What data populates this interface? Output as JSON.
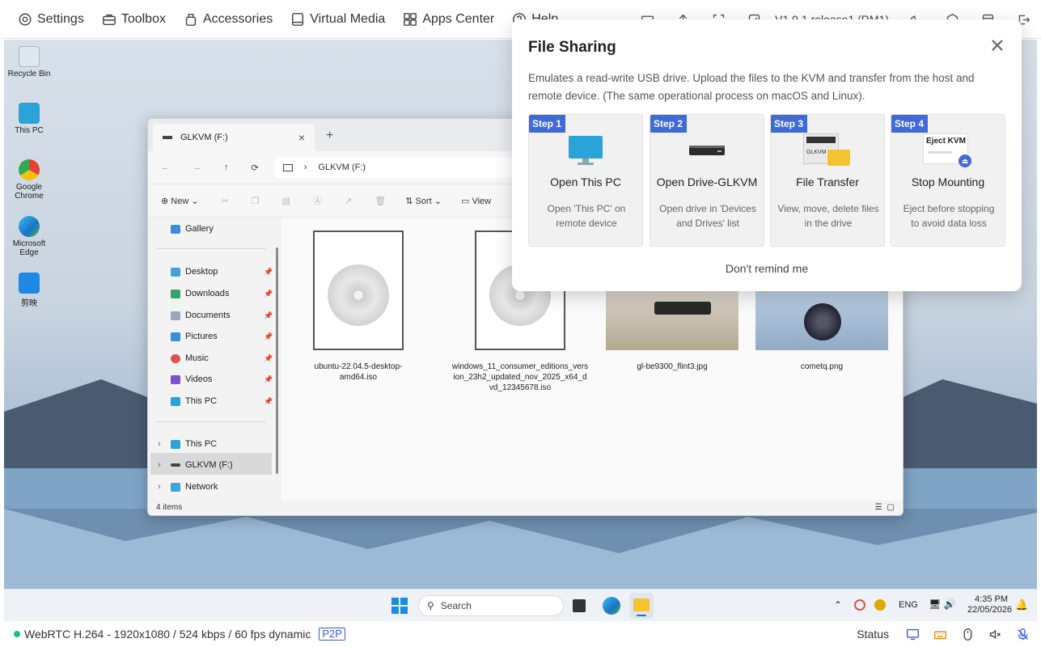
{
  "toolbar": {
    "items": [
      {
        "label": "Settings",
        "icon": "gear-icon"
      },
      {
        "label": "Toolbox",
        "icon": "toolbox-icon"
      },
      {
        "label": "Accessories",
        "icon": "accessories-icon"
      },
      {
        "label": "Virtual Media",
        "icon": "media-icon"
      },
      {
        "label": "Apps Center",
        "icon": "apps-icon"
      },
      {
        "label": "Help",
        "icon": "help-icon"
      }
    ],
    "version": "V1.9.1 release1 (RM1)"
  },
  "desktop": {
    "icons": [
      "Recycle Bin",
      "This PC",
      "Google Chrome",
      "Microsoft Edge",
      "剪映"
    ]
  },
  "explorer": {
    "tab_title": "GLKVM (F:)",
    "address": "GLKVM (F:)",
    "commands": {
      "new": "New",
      "sort": "Sort",
      "view": "View"
    },
    "sidebar": {
      "gallery": "Gallery",
      "quick": [
        "Desktop",
        "Downloads",
        "Documents",
        "Pictures",
        "Music",
        "Videos",
        "This PC"
      ],
      "tree": [
        "This PC",
        "GLKVM (F:)",
        "Network"
      ]
    },
    "files": [
      "ubuntu-22.04.5-desktop-amd64.iso",
      "windows_11_consumer_editions_version_23h2_updated_nov_2025_x64_dvd_12345678.iso",
      "gl-be9300_flint3.jpg",
      "cometq.png"
    ],
    "status": "4 items"
  },
  "taskbar": {
    "search": "Search",
    "lang": "ENG",
    "time": "4:35 PM",
    "date": "22/05/2026"
  },
  "dialog": {
    "title": "File Sharing",
    "description": "Emulates a read-write USB drive. Upload the files to the KVM and transfer from the host and remote device. (The same operational process on macOS and Linux).",
    "steps": [
      {
        "badge": "Step 1",
        "title": "Open This PC",
        "desc": "Open 'This PC' on remote device"
      },
      {
        "badge": "Step 2",
        "title": "Open Drive-GLKVM",
        "desc": "Open drive in 'Devices and Drives' list"
      },
      {
        "badge": "Step 3",
        "title": "File Transfer",
        "desc": "View, move, delete files in the drive",
        "img_label": "GLKVM"
      },
      {
        "badge": "Step 4",
        "title": "Stop Mounting",
        "desc": "Eject before stopping to avoid data loss",
        "img_label": "Eject KVM"
      }
    ],
    "footer": "Don't remind me"
  },
  "statusbar": {
    "stream": "WebRTC H.264 - 1920x1080 /  524 kbps / 60 fps dynamic",
    "badge": "P2P",
    "status_label": "Status"
  },
  "colors": {
    "accent": "#3f6ad8",
    "connected": "#1bbf8a"
  }
}
